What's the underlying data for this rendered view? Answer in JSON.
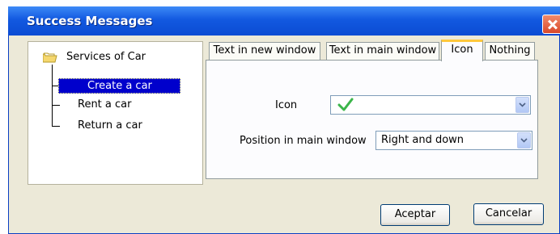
{
  "window": {
    "title": "Success Messages"
  },
  "tree": {
    "root_label": "Services of Car",
    "items": [
      {
        "label": "Create a car",
        "selected": true
      },
      {
        "label": "Rent a car",
        "selected": false
      },
      {
        "label": "Return a car",
        "selected": false
      }
    ]
  },
  "tabs": [
    {
      "label": "Text in new window",
      "active": false
    },
    {
      "label": "Text in main window",
      "active": false
    },
    {
      "label": "Icon",
      "active": true
    },
    {
      "label": "Nothing",
      "active": false
    }
  ],
  "icon_tab": {
    "icon_label": "Icon",
    "icon_value_icon": "checkmark-icon",
    "position_label": "Position in main window",
    "position_value": "Right and down"
  },
  "buttons": {
    "accept": "Aceptar",
    "cancel": "Cancelar"
  },
  "colors": {
    "titlebar": "#0b4bd3",
    "selection": "#0000cc",
    "active_tab_accent": "#ffc83c",
    "check": "#3bb54a"
  }
}
